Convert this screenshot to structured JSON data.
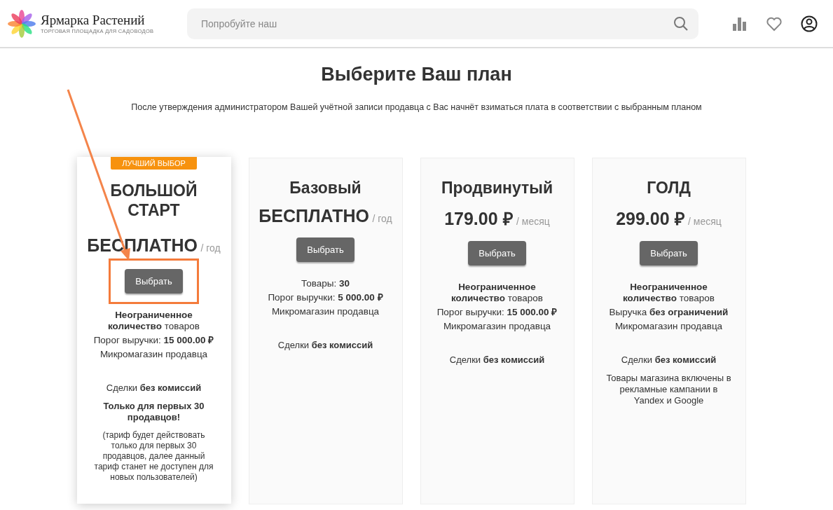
{
  "header": {
    "logo_title": "Ярмарка Растений",
    "logo_subtitle": "ТОРГОВАЯ ПЛОЩАДКА ДЛЯ САДОВОДОВ",
    "search": {
      "placeholder": "Попробуйте наш"
    }
  },
  "title": "Выберите Ваш план",
  "subtitle": "После утверждения администратором Вашей учётной записи продавца с Вас начнёт взиматься плата в соответствии с выбранным планом",
  "plans": [
    {
      "featured": true,
      "badge": "ЛУЧШИЙ ВЫБОР",
      "name": "БОЛЬШОЙ СТАРТ",
      "price": "БЕСПЛАТНО",
      "period": "/ год",
      "button": "Выбрать",
      "button_highlighted": true,
      "features": [
        "**Неограниченное количество** товаров",
        "Порог выручки: **15 000.00 ₽**",
        "Микромагазин продавца"
      ],
      "notes": [
        "Сделки **без комиссий**",
        "**Только для первых 30 продавцов!**",
        "(тариф будет действовать только для первых 30 продавцов, далее данный тариф станет не доступен для новых пользователей)"
      ]
    },
    {
      "featured": false,
      "name": "Базовый",
      "price": "БЕСПЛАТНО",
      "period": "/ год",
      "button": "Выбрать",
      "button_highlighted": false,
      "features": [
        "Товары: **30**",
        "Порог выручки: **5 000.00 ₽**",
        "Микромагазин продавца"
      ],
      "notes": [
        "Сделки **без комиссий**"
      ]
    },
    {
      "featured": false,
      "name": "Продвинутый",
      "price": "179.00 ₽",
      "period": "/ месяц",
      "button": "Выбрать",
      "button_highlighted": false,
      "features": [
        "**Неограниченное количество** товаров",
        "Порог выручки: **15 000.00 ₽**",
        "Микромагазин продавца"
      ],
      "notes": [
        "Сделки **без комиссий**"
      ]
    },
    {
      "featured": false,
      "name": "ГОЛД",
      "price": "299.00 ₽",
      "period": "/ месяц",
      "button": "Выбрать",
      "button_highlighted": false,
      "features": [
        "**Неограниченное количество** товаров",
        "Выручка **без ограничений**",
        "Микромагазин продавца"
      ],
      "notes": [
        "Сделки **без комиссий**",
        "Товары магазина включены в рекламные кампании в Yandex и Google"
      ]
    }
  ]
}
